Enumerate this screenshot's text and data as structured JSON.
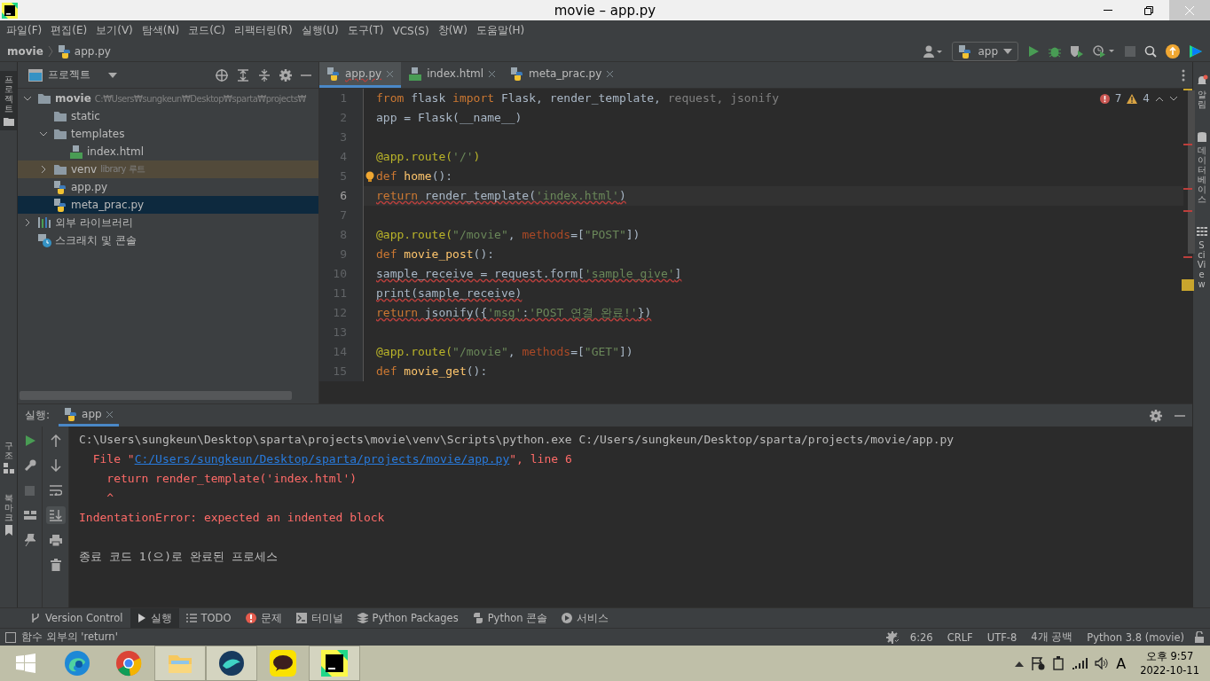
{
  "window": {
    "title": "movie – app.py"
  },
  "menu": [
    "파일(F)",
    "편집(E)",
    "보기(V)",
    "탐색(N)",
    "코드(C)",
    "리팩터링(R)",
    "실행(U)",
    "도구(T)",
    "VCS(S)",
    "창(W)",
    "도움말(H)"
  ],
  "breadcrumb": [
    {
      "label": "movie",
      "kind": "project"
    },
    {
      "label": "app.py",
      "kind": "python"
    }
  ],
  "run_config": "app",
  "left_stripe": [
    {
      "label": "프로젝트",
      "kind": "folder"
    },
    {
      "label": "구조",
      "kind": "structure"
    },
    {
      "label": "북마크",
      "kind": "bookmark"
    }
  ],
  "right_stripe": [
    {
      "label": "알림",
      "kind": "bell"
    },
    {
      "label": "데이터베이스",
      "kind": "database"
    },
    {
      "label": "SciView",
      "kind": "grid"
    }
  ],
  "project_panel": {
    "title": "프로젝트",
    "tree": [
      {
        "label": "movie",
        "kind": "folder",
        "hint": "C:₩Users₩sungkeun₩Desktop₩sparta₩projects₩",
        "expanded": true,
        "selected": false,
        "tinted": false,
        "children": [
          {
            "label": "static",
            "kind": "folder",
            "selected": false,
            "tinted": false
          },
          {
            "label": "templates",
            "kind": "folder",
            "expanded": true,
            "selected": false,
            "tinted": false,
            "children": [
              {
                "label": "index.html",
                "kind": "html",
                "selected": false,
                "tinted": false
              }
            ]
          },
          {
            "label": "venv",
            "kind": "folder",
            "hint": "library 루트",
            "expanded": false,
            "selected": false,
            "tinted": true
          },
          {
            "label": "app.py",
            "kind": "python",
            "selected": false,
            "tinted": false
          },
          {
            "label": "meta_prac.py",
            "kind": "python",
            "selected": true,
            "tinted": false
          }
        ]
      },
      {
        "label": "외부 라이브러리",
        "kind": "library",
        "expanded": false,
        "selected": false,
        "tinted": false
      },
      {
        "label": "스크래치 및 콘솔",
        "kind": "scratch",
        "selected": false,
        "tinted": false
      }
    ]
  },
  "editor": {
    "tabs": [
      {
        "label": "app.py",
        "kind": "python",
        "selected": true
      },
      {
        "label": "index.html",
        "kind": "html",
        "selected": false
      },
      {
        "label": "meta_prac.py",
        "kind": "python",
        "selected": false
      }
    ],
    "errors": "7",
    "warnings": "4",
    "lines": [
      {
        "number": "1",
        "current": false,
        "error": false,
        "tokens": [
          {
            "kind": "keyword",
            "text": "from"
          },
          {
            "kind": "plain",
            "text": " flask "
          },
          {
            "kind": "keyword",
            "text": "import"
          },
          {
            "kind": "plain",
            "text": " Flask, render_template, "
          },
          {
            "kind": "unused",
            "text": "request, jsonify"
          }
        ]
      },
      {
        "number": "2",
        "current": false,
        "error": false,
        "tokens": [
          {
            "kind": "plain",
            "text": "app = Flask(__name__)"
          }
        ]
      },
      {
        "number": "3",
        "current": false
      },
      {
        "number": "4",
        "current": false,
        "error": false,
        "tokens": [
          {
            "kind": "decorator",
            "text": "@app.route("
          },
          {
            "kind": "string",
            "text": "'/'"
          },
          {
            "kind": "decorator",
            "text": ")"
          }
        ]
      },
      {
        "number": "5",
        "current": false,
        "error": false,
        "bulb": true,
        "tokens": [
          {
            "kind": "keyword",
            "text": "def"
          },
          {
            "kind": "function",
            "text": " home"
          },
          {
            "kind": "plain",
            "text": "():"
          }
        ]
      },
      {
        "number": "6",
        "current": true,
        "error": true,
        "tokens": [
          {
            "kind": "keyword",
            "text": "return"
          },
          {
            "kind": "plain",
            "text": " render_template("
          },
          {
            "kind": "string",
            "text": "'index.html'"
          },
          {
            "kind": "plain",
            "text": ")"
          }
        ]
      },
      {
        "number": "7",
        "current": false
      },
      {
        "number": "8",
        "current": false,
        "error": false,
        "tokens": [
          {
            "kind": "decorator",
            "text": "@app.route("
          },
          {
            "kind": "string",
            "text": "\"/movie\""
          },
          {
            "kind": "plain",
            "text": ", "
          },
          {
            "kind": "param",
            "text": "methods"
          },
          {
            "kind": "plain",
            "text": "=["
          },
          {
            "kind": "string",
            "text": "\"POST\""
          },
          {
            "kind": "plain",
            "text": "])"
          }
        ]
      },
      {
        "number": "9",
        "current": false,
        "error": false,
        "tokens": [
          {
            "kind": "keyword",
            "text": "def"
          },
          {
            "kind": "function",
            "text": " movie_post"
          },
          {
            "kind": "plain",
            "text": "():"
          }
        ]
      },
      {
        "number": "10",
        "current": false,
        "error": true,
        "tokens": [
          {
            "kind": "plain",
            "text": "sample_receive = request.form["
          },
          {
            "kind": "string",
            "text": "'sample_give'"
          },
          {
            "kind": "plain",
            "text": "]"
          }
        ]
      },
      {
        "number": "11",
        "current": false,
        "error": true,
        "tokens": [
          {
            "kind": "plain",
            "text": "print(sample_receive)"
          }
        ]
      },
      {
        "number": "12",
        "current": false,
        "error": true,
        "tokens": [
          {
            "kind": "keyword",
            "text": "return"
          },
          {
            "kind": "plain",
            "text": " jsonify({"
          },
          {
            "kind": "string",
            "text": "'msg'"
          },
          {
            "kind": "plain",
            "text": ":"
          },
          {
            "kind": "string",
            "text": "'POST 연결 완료!'"
          },
          {
            "kind": "plain",
            "text": "})"
          }
        ]
      },
      {
        "number": "13",
        "current": false
      },
      {
        "number": "14",
        "current": false,
        "error": false,
        "tokens": [
          {
            "kind": "decorator",
            "text": "@app.route("
          },
          {
            "kind": "string",
            "text": "\"/movie\""
          },
          {
            "kind": "plain",
            "text": ", "
          },
          {
            "kind": "param",
            "text": "methods"
          },
          {
            "kind": "plain",
            "text": "=["
          },
          {
            "kind": "string",
            "text": "\"GET\""
          },
          {
            "kind": "plain",
            "text": "])"
          }
        ]
      },
      {
        "number": "15",
        "current": false,
        "error": false,
        "tokens": [
          {
            "kind": "keyword",
            "text": "def"
          },
          {
            "kind": "function",
            "text": " movie_get"
          },
          {
            "kind": "plain",
            "text": "():"
          }
        ]
      }
    ]
  },
  "run_panel": {
    "label": "실행:",
    "tabs": [
      {
        "label": "app",
        "selected": true
      }
    ],
    "console": [
      {
        "lines": [
          [
            {
              "kind": "plain",
              "text": "C:\\Users\\sungkeun\\Desktop\\sparta\\projects\\movie\\venv\\Scripts\\python.exe C:/Users/sungkeun/Desktop/sparta/projects/movie/app.py"
            }
          ],
          [
            {
              "kind": "error",
              "text": "  File \""
            },
            {
              "kind": "link",
              "text": "C:/Users/sungkeun/Desktop/sparta/projects/movie/app.py"
            },
            {
              "kind": "error",
              "text": "\", line 6"
            }
          ],
          [
            {
              "kind": "error",
              "text": "    return render_template('index.html')"
            }
          ],
          [
            {
              "kind": "error",
              "text": "    ^"
            }
          ],
          [
            {
              "kind": "error",
              "text": "IndentationError: expected an indented block"
            }
          ]
        ]
      },
      {
        "lines": [
          [
            {
              "kind": "plain",
              "text": "종료 코드 1(으)로 완료된 프로세스"
            }
          ]
        ]
      }
    ]
  },
  "tool_windows": [
    {
      "label": "Version Control",
      "kind": "vcs",
      "selected": false
    },
    {
      "label": "실행",
      "kind": "run",
      "selected": true
    },
    {
      "label": "TODO",
      "kind": "todo",
      "selected": false
    },
    {
      "label": "문제",
      "kind": "problems",
      "selected": false
    },
    {
      "label": "터미널",
      "kind": "terminal",
      "selected": false
    },
    {
      "label": "Python Packages",
      "kind": "packages",
      "selected": false
    },
    {
      "label": "Python 콘솔",
      "kind": "python",
      "selected": false
    },
    {
      "label": "서비스",
      "kind": "services",
      "selected": false
    }
  ],
  "status_bar": {
    "message": "함수 외부의 'return'",
    "items": [
      "6:26",
      "CRLF",
      "UTF-8",
      "4개 공백",
      "Python 3.8 (movie)"
    ]
  },
  "taskbar": {
    "apps": [
      {
        "kind": "edge",
        "selected": false
      },
      {
        "kind": "chrome",
        "selected": false
      },
      {
        "kind": "explorer",
        "selected": true
      },
      {
        "kind": "whale",
        "selected": true
      },
      {
        "kind": "kakaotalk",
        "selected": false
      },
      {
        "kind": "pycharm",
        "selected": true
      }
    ],
    "ime": "A",
    "time": "오후 9:57",
    "date": "2022-10-11"
  }
}
